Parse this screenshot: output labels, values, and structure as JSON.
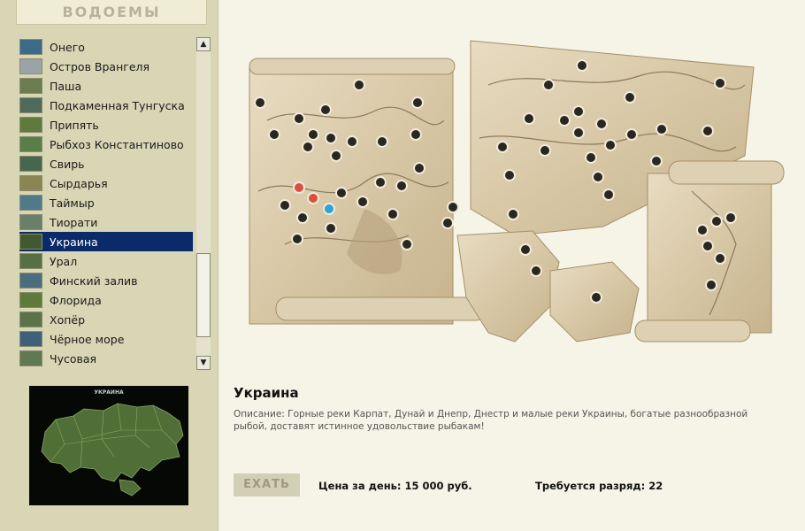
{
  "sidebar": {
    "title": "ВОДОЕМЫ",
    "items": [
      {
        "label": "Онего",
        "icon": "lake-thumbnail",
        "color": "#3b6a8a"
      },
      {
        "label": "Остров Врангеля",
        "icon": "island-thumbnail",
        "color": "#9aa3a8"
      },
      {
        "label": "Паша",
        "icon": "river-thumbnail",
        "color": "#6b7d4e"
      },
      {
        "label": "Подкаменная Тунгуска",
        "icon": "river-thumbnail",
        "color": "#4f6a5c"
      },
      {
        "label": "Припять",
        "icon": "river-thumbnail",
        "color": "#5f7a3e"
      },
      {
        "label": "Рыбхоз Константиново",
        "icon": "pond-thumbnail",
        "color": "#587f48"
      },
      {
        "label": "Свирь",
        "icon": "river-thumbnail",
        "color": "#47664f"
      },
      {
        "label": "Сырдарья",
        "icon": "river-thumbnail",
        "color": "#8a8654"
      },
      {
        "label": "Таймыр",
        "icon": "lake-thumbnail",
        "color": "#4f7a8a"
      },
      {
        "label": "Тиорати",
        "icon": "lake-thumbnail",
        "color": "#6a7f6a"
      },
      {
        "label": "Украина",
        "icon": "map-thumbnail",
        "color": "#3e5a2e",
        "selected": true
      },
      {
        "label": "Урал",
        "icon": "river-thumbnail",
        "color": "#567044"
      },
      {
        "label": "Финский залив",
        "icon": "bay-thumbnail",
        "color": "#4a6e7e"
      },
      {
        "label": "Флорида",
        "icon": "swamp-thumbnail",
        "color": "#5d7a3a"
      },
      {
        "label": "Хопёр",
        "icon": "river-thumbnail",
        "color": "#5a7448"
      },
      {
        "label": "Чёрное море",
        "icon": "sea-thumbnail",
        "color": "#3f5f7a"
      },
      {
        "label": "Чусовая",
        "icon": "river-thumbnail",
        "color": "#5f7a52"
      }
    ],
    "scroll": {
      "up_glyph": "▲",
      "down_glyph": "▼"
    }
  },
  "preview": {
    "title": "УКРАИНА"
  },
  "map": {
    "marker_color": "#2a2622",
    "active_marker_color": "#d9503f",
    "selected_marker_color": "#2aa3d6"
  },
  "region": {
    "title": "Украина",
    "description": "Описание: Горные реки Карпат, Дунай и Днепр, Днестр и малые реки Украины, богатые  разнообразной рыбой, доставят истинное удовольствие рыбакам!"
  },
  "actions": {
    "go_label": "ЕХАТЬ"
  },
  "info": {
    "price": "Цена за день: 15 000 руб.",
    "rank": "Требуется разряд: 22"
  }
}
